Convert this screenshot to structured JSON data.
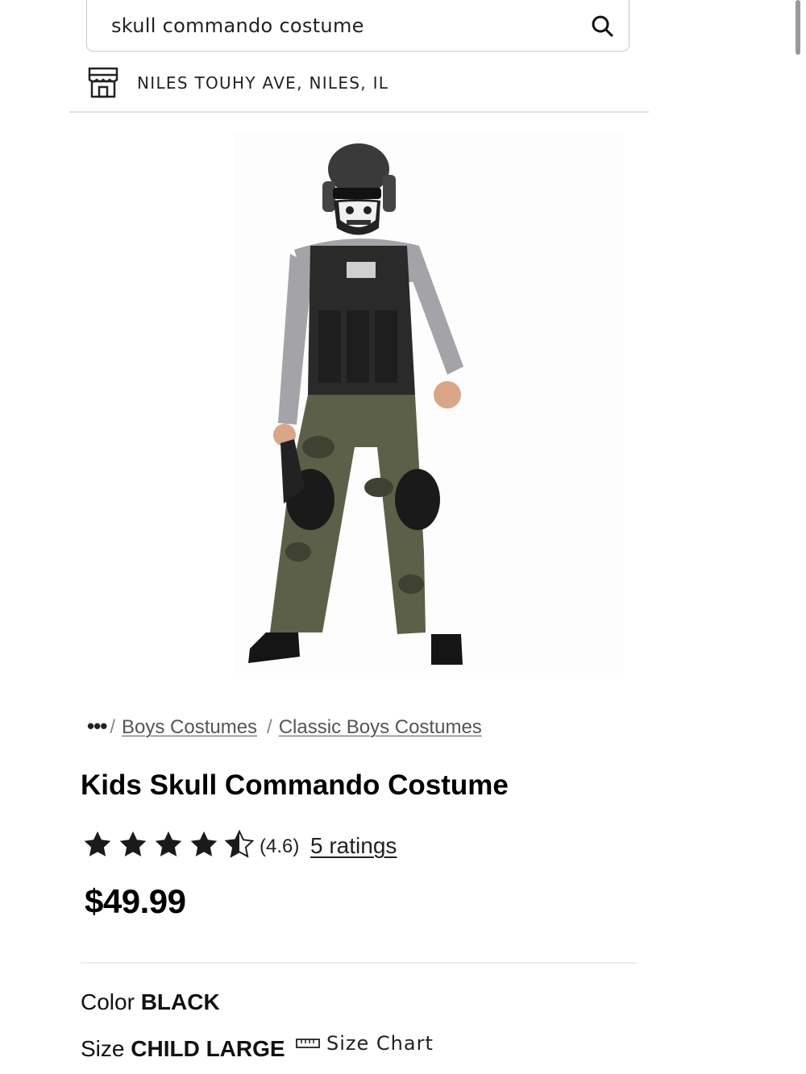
{
  "search": {
    "query": "skull commando costume",
    "icon": "search-icon"
  },
  "store": {
    "label": "NILES TOUHY AVE, NILES, IL",
    "icon": "store-icon"
  },
  "product_image": {
    "alt": "Kids Skull Commando Costume"
  },
  "breadcrumb": {
    "ellipsis": "•••",
    "separator": "/",
    "items": [
      {
        "label": "Boys Costumes"
      },
      {
        "label": "Classic Boys Costumes"
      }
    ]
  },
  "product": {
    "title": "Kids Skull Commando Costume",
    "rating": 4.6,
    "rating_text": "(4.6)",
    "ratings_link": "5 ratings",
    "price": "$49.99"
  },
  "options": {
    "color_label": "Color",
    "color_value": "BLACK",
    "size_label": "Size",
    "size_value": "CHILD LARGE",
    "size_chart": "Size Chart"
  },
  "colors": {
    "text": "#111111",
    "divider": "#e1e1e1"
  }
}
